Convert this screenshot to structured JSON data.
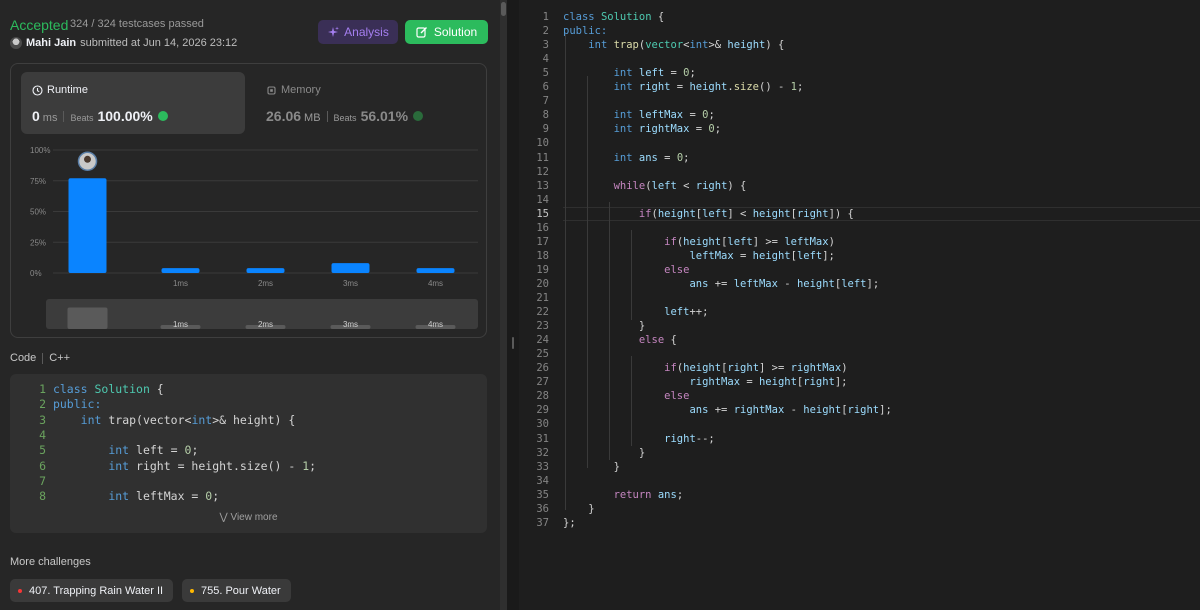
{
  "submission": {
    "status": "Accepted",
    "testcases": "324 / 324 testcases passed",
    "user_name": "Mahi Jain",
    "submitted_text": "submitted at Jun 14, 2026 23:12",
    "analysis_label": "Analysis",
    "solution_label": "Solution"
  },
  "runtime": {
    "title": "Runtime",
    "value": "0",
    "unit": "ms",
    "beats_label": "Beats",
    "percent": "100.00%"
  },
  "memory": {
    "title": "Memory",
    "value": "26.06",
    "unit": "MB",
    "beats_label": "Beats",
    "percent": "56.01%"
  },
  "chart_data": {
    "type": "bar",
    "y_ticks": [
      "100%",
      "75%",
      "50%",
      "25%",
      "0%"
    ],
    "ylim": [
      0,
      100
    ],
    "categories": [
      "",
      "1ms",
      "2ms",
      "3ms",
      "4ms"
    ],
    "values": [
      77,
      4,
      4,
      8,
      4
    ],
    "highlight_color": "#0a84ff",
    "mini_labels": [
      "1ms",
      "2ms",
      "3ms",
      "4ms"
    ]
  },
  "code_section": {
    "label": "Code",
    "language": "C++",
    "view_more": "View more"
  },
  "more": {
    "title": "More challenges",
    "items": [
      {
        "label": "407. Trapping Rain Water II",
        "color": "#f63636"
      },
      {
        "label": "755. Pour Water",
        "color": "#ffb800"
      }
    ]
  },
  "preview_lines": [
    [
      {
        "t": "class ",
        "c": "kw"
      },
      {
        "t": "Solution",
        "c": "ty"
      },
      {
        "t": " {",
        "c": "pl"
      }
    ],
    [
      {
        "t": "public:",
        "c": "kw"
      }
    ],
    [
      {
        "t": "    ",
        "c": "pl"
      },
      {
        "t": "int",
        "c": "kw"
      },
      {
        "t": " trap(vector<",
        "c": "pl"
      },
      {
        "t": "int",
        "c": "kw"
      },
      {
        "t": ">& height) {",
        "c": "pl"
      }
    ],
    [],
    [
      {
        "t": "        ",
        "c": "pl"
      },
      {
        "t": "int",
        "c": "kw"
      },
      {
        "t": " left = ",
        "c": "pl"
      },
      {
        "t": "0",
        "c": "num"
      },
      {
        "t": ";",
        "c": "pl"
      }
    ],
    [
      {
        "t": "        ",
        "c": "pl"
      },
      {
        "t": "int",
        "c": "kw"
      },
      {
        "t": " right = height.size() - ",
        "c": "pl"
      },
      {
        "t": "1",
        "c": "num"
      },
      {
        "t": ";",
        "c": "pl"
      }
    ],
    [],
    [
      {
        "t": "        ",
        "c": "pl"
      },
      {
        "t": "int",
        "c": "kw"
      },
      {
        "t": " leftMax = ",
        "c": "pl"
      },
      {
        "t": "0",
        "c": "num"
      },
      {
        "t": ";",
        "c": "pl"
      }
    ]
  ],
  "editor_lines": [
    [
      {
        "t": "class ",
        "c": "kw"
      },
      {
        "t": "Solution",
        "c": "ty"
      },
      {
        "t": " {",
        "c": "pl"
      }
    ],
    [
      {
        "t": "public:",
        "c": "kw"
      }
    ],
    [
      {
        "t": "    ",
        "c": "pl"
      },
      {
        "t": "int",
        "c": "kw"
      },
      {
        "t": " ",
        "c": "pl"
      },
      {
        "t": "trap",
        "c": "fn"
      },
      {
        "t": "(",
        "c": "pl"
      },
      {
        "t": "vector",
        "c": "ty"
      },
      {
        "t": "<",
        "c": "pl"
      },
      {
        "t": "int",
        "c": "kw"
      },
      {
        "t": ">& ",
        "c": "pl"
      },
      {
        "t": "height",
        "c": "var"
      },
      {
        "t": ") {",
        "c": "pl"
      }
    ],
    [],
    [
      {
        "t": "        ",
        "c": "pl"
      },
      {
        "t": "int",
        "c": "kw"
      },
      {
        "t": " ",
        "c": "pl"
      },
      {
        "t": "left",
        "c": "var"
      },
      {
        "t": " = ",
        "c": "pl"
      },
      {
        "t": "0",
        "c": "num"
      },
      {
        "t": ";",
        "c": "pl"
      }
    ],
    [
      {
        "t": "        ",
        "c": "pl"
      },
      {
        "t": "int",
        "c": "kw"
      },
      {
        "t": " ",
        "c": "pl"
      },
      {
        "t": "right",
        "c": "var"
      },
      {
        "t": " = ",
        "c": "pl"
      },
      {
        "t": "height",
        "c": "var"
      },
      {
        "t": ".",
        "c": "pl"
      },
      {
        "t": "size",
        "c": "fn"
      },
      {
        "t": "() - ",
        "c": "pl"
      },
      {
        "t": "1",
        "c": "num"
      },
      {
        "t": ";",
        "c": "pl"
      }
    ],
    [],
    [
      {
        "t": "        ",
        "c": "pl"
      },
      {
        "t": "int",
        "c": "kw"
      },
      {
        "t": " ",
        "c": "pl"
      },
      {
        "t": "leftMax",
        "c": "var"
      },
      {
        "t": " = ",
        "c": "pl"
      },
      {
        "t": "0",
        "c": "num"
      },
      {
        "t": ";",
        "c": "pl"
      }
    ],
    [
      {
        "t": "        ",
        "c": "pl"
      },
      {
        "t": "int",
        "c": "kw"
      },
      {
        "t": " ",
        "c": "pl"
      },
      {
        "t": "rightMax",
        "c": "var"
      },
      {
        "t": " = ",
        "c": "pl"
      },
      {
        "t": "0",
        "c": "num"
      },
      {
        "t": ";",
        "c": "pl"
      }
    ],
    [],
    [
      {
        "t": "        ",
        "c": "pl"
      },
      {
        "t": "int",
        "c": "kw"
      },
      {
        "t": " ",
        "c": "pl"
      },
      {
        "t": "ans",
        "c": "var"
      },
      {
        "t": " = ",
        "c": "pl"
      },
      {
        "t": "0",
        "c": "num"
      },
      {
        "t": ";",
        "c": "pl"
      }
    ],
    [],
    [
      {
        "t": "        ",
        "c": "pl"
      },
      {
        "t": "while",
        "c": "ctl"
      },
      {
        "t": "(",
        "c": "pl"
      },
      {
        "t": "left",
        "c": "var"
      },
      {
        "t": " < ",
        "c": "pl"
      },
      {
        "t": "right",
        "c": "var"
      },
      {
        "t": ") {",
        "c": "pl"
      }
    ],
    [],
    [
      {
        "t": "            ",
        "c": "pl"
      },
      {
        "t": "if",
        "c": "ctl"
      },
      {
        "t": "(",
        "c": "pl"
      },
      {
        "t": "height",
        "c": "var"
      },
      {
        "t": "[",
        "c": "pl"
      },
      {
        "t": "left",
        "c": "var"
      },
      {
        "t": "] < ",
        "c": "pl"
      },
      {
        "t": "height",
        "c": "var"
      },
      {
        "t": "[",
        "c": "pl"
      },
      {
        "t": "right",
        "c": "var"
      },
      {
        "t": "]) {",
        "c": "pl"
      }
    ],
    [],
    [
      {
        "t": "                ",
        "c": "pl"
      },
      {
        "t": "if",
        "c": "ctl"
      },
      {
        "t": "(",
        "c": "pl"
      },
      {
        "t": "height",
        "c": "var"
      },
      {
        "t": "[",
        "c": "pl"
      },
      {
        "t": "left",
        "c": "var"
      },
      {
        "t": "] >= ",
        "c": "pl"
      },
      {
        "t": "leftMax",
        "c": "var"
      },
      {
        "t": ")",
        "c": "pl"
      }
    ],
    [
      {
        "t": "                    ",
        "c": "pl"
      },
      {
        "t": "leftMax",
        "c": "var"
      },
      {
        "t": " = ",
        "c": "pl"
      },
      {
        "t": "height",
        "c": "var"
      },
      {
        "t": "[",
        "c": "pl"
      },
      {
        "t": "left",
        "c": "var"
      },
      {
        "t": "];",
        "c": "pl"
      }
    ],
    [
      {
        "t": "                ",
        "c": "pl"
      },
      {
        "t": "else",
        "c": "ctl"
      }
    ],
    [
      {
        "t": "                    ",
        "c": "pl"
      },
      {
        "t": "ans",
        "c": "var"
      },
      {
        "t": " += ",
        "c": "pl"
      },
      {
        "t": "leftMax",
        "c": "var"
      },
      {
        "t": " - ",
        "c": "pl"
      },
      {
        "t": "height",
        "c": "var"
      },
      {
        "t": "[",
        "c": "pl"
      },
      {
        "t": "left",
        "c": "var"
      },
      {
        "t": "];",
        "c": "pl"
      }
    ],
    [],
    [
      {
        "t": "                ",
        "c": "pl"
      },
      {
        "t": "left",
        "c": "var"
      },
      {
        "t": "++;",
        "c": "pl"
      }
    ],
    [
      {
        "t": "            }",
        "c": "pl"
      }
    ],
    [
      {
        "t": "            ",
        "c": "pl"
      },
      {
        "t": "else",
        "c": "ctl"
      },
      {
        "t": " {",
        "c": "pl"
      }
    ],
    [],
    [
      {
        "t": "                ",
        "c": "pl"
      },
      {
        "t": "if",
        "c": "ctl"
      },
      {
        "t": "(",
        "c": "pl"
      },
      {
        "t": "height",
        "c": "var"
      },
      {
        "t": "[",
        "c": "pl"
      },
      {
        "t": "right",
        "c": "var"
      },
      {
        "t": "] >= ",
        "c": "pl"
      },
      {
        "t": "rightMax",
        "c": "var"
      },
      {
        "t": ")",
        "c": "pl"
      }
    ],
    [
      {
        "t": "                    ",
        "c": "pl"
      },
      {
        "t": "rightMax",
        "c": "var"
      },
      {
        "t": " = ",
        "c": "pl"
      },
      {
        "t": "height",
        "c": "var"
      },
      {
        "t": "[",
        "c": "pl"
      },
      {
        "t": "right",
        "c": "var"
      },
      {
        "t": "];",
        "c": "pl"
      }
    ],
    [
      {
        "t": "                ",
        "c": "pl"
      },
      {
        "t": "else",
        "c": "ctl"
      }
    ],
    [
      {
        "t": "                    ",
        "c": "pl"
      },
      {
        "t": "ans",
        "c": "var"
      },
      {
        "t": " += ",
        "c": "pl"
      },
      {
        "t": "rightMax",
        "c": "var"
      },
      {
        "t": " - ",
        "c": "pl"
      },
      {
        "t": "height",
        "c": "var"
      },
      {
        "t": "[",
        "c": "pl"
      },
      {
        "t": "right",
        "c": "var"
      },
      {
        "t": "];",
        "c": "pl"
      }
    ],
    [],
    [
      {
        "t": "                ",
        "c": "pl"
      },
      {
        "t": "right",
        "c": "var"
      },
      {
        "t": "--;",
        "c": "pl"
      }
    ],
    [
      {
        "t": "            }",
        "c": "pl"
      }
    ],
    [
      {
        "t": "        }",
        "c": "pl"
      }
    ],
    [],
    [
      {
        "t": "        ",
        "c": "pl"
      },
      {
        "t": "return",
        "c": "ctl"
      },
      {
        "t": " ",
        "c": "pl"
      },
      {
        "t": "ans",
        "c": "var"
      },
      {
        "t": ";",
        "c": "pl"
      }
    ],
    [
      {
        "t": "    }",
        "c": "pl"
      }
    ],
    [
      {
        "t": "};",
        "c": "pl"
      }
    ]
  ]
}
